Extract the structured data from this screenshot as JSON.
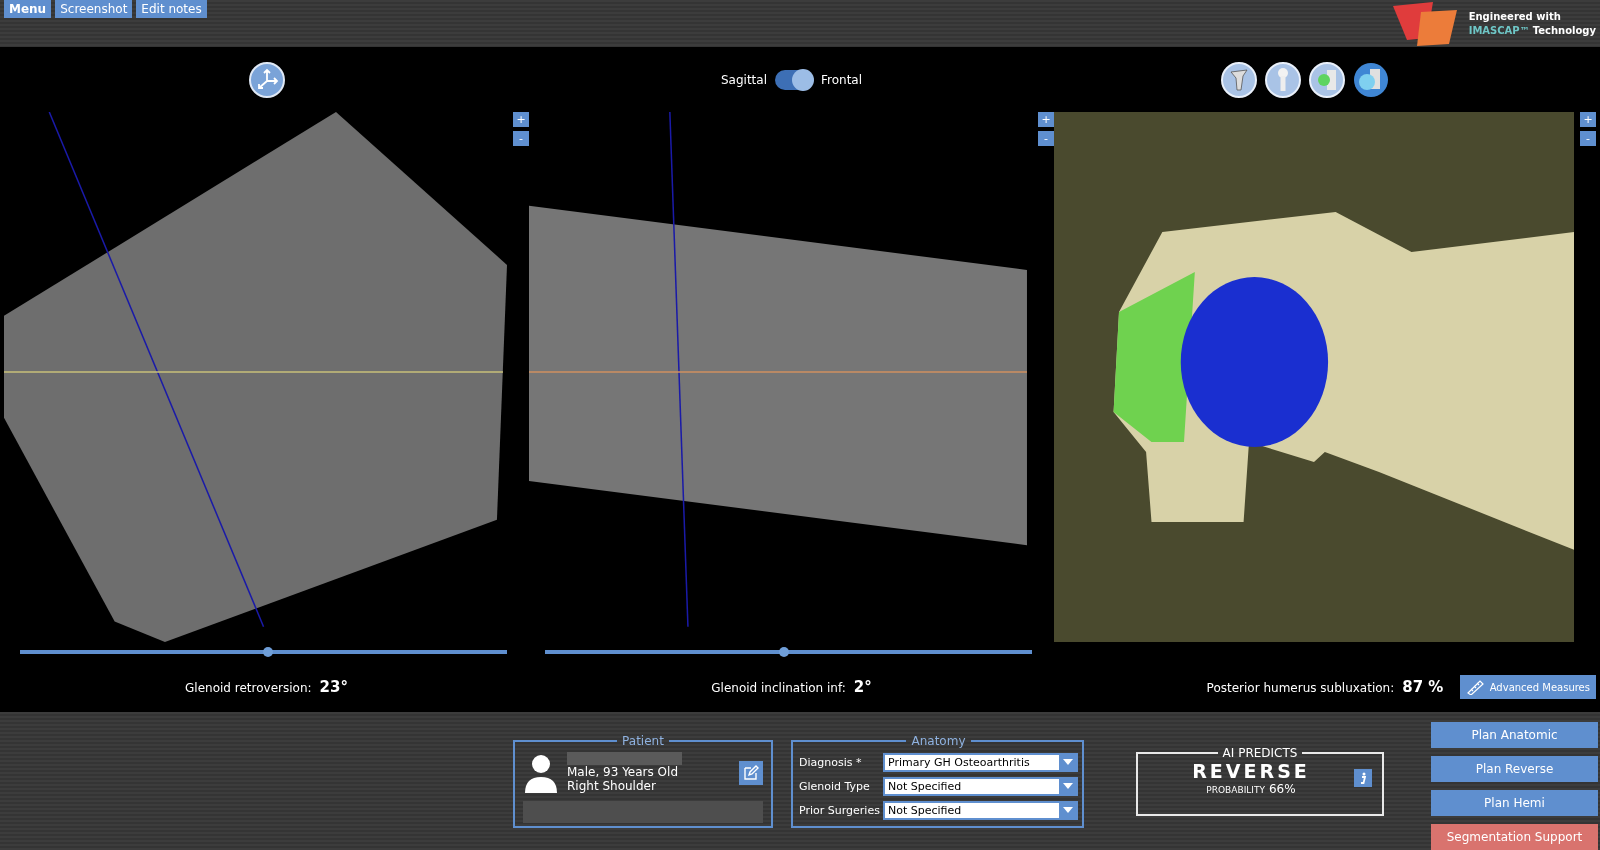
{
  "toolbar": [
    {
      "label": "Menu",
      "selected": true
    },
    {
      "label": "Screenshot",
      "selected": false
    },
    {
      "label": "Edit notes",
      "selected": false
    }
  ],
  "logo": {
    "line1": "Engineered with",
    "brand": "IMASCAP™",
    "line2": "Technology"
  },
  "views": [
    {
      "kind": "axial",
      "zoom": [
        "+",
        "-"
      ],
      "slider": {
        "level": 0.51
      },
      "measure_label": "Glenoid retroversion:",
      "measure_value": "23°"
    },
    {
      "kind": "frontal",
      "toggle": {
        "left": "Sagittal",
        "right": "Frontal",
        "on": true
      },
      "zoom": [
        "+",
        "-"
      ],
      "slider": {
        "level": 0.49
      },
      "measure_label": "Glenoid inclination inf:",
      "measure_value": "2°"
    },
    {
      "kind": "model",
      "zoom": [
        "+",
        "-"
      ],
      "measure_label": "Posterior humerus subluxation:",
      "measure_value": "87 %",
      "button": "Advanced Measures"
    }
  ],
  "patient": {
    "title": "Patient",
    "lines": [
      "Male, 93 Years Old",
      "Right Shoulder"
    ]
  },
  "anatomy": {
    "title": "Anatomy",
    "fields": [
      {
        "label": "Diagnosis *",
        "value": "Primary GH Osteoarthritis"
      },
      {
        "label": "Glenoid Type",
        "value": "Not Specified"
      },
      {
        "label": "Prior Surgeries",
        "value": "Not Specified"
      }
    ]
  },
  "ai": {
    "title": "AI PREDICTS",
    "result": "REVERSE",
    "probability_label": "PROBABILITY",
    "probability": "66%"
  },
  "actions": [
    {
      "label": "Plan Anatomic",
      "kind": "plan"
    },
    {
      "label": "Plan Reverse",
      "kind": "plan"
    },
    {
      "label": "Plan Hemi",
      "kind": "plan"
    },
    {
      "label": "Segmentation Support",
      "kind": "support"
    }
  ]
}
